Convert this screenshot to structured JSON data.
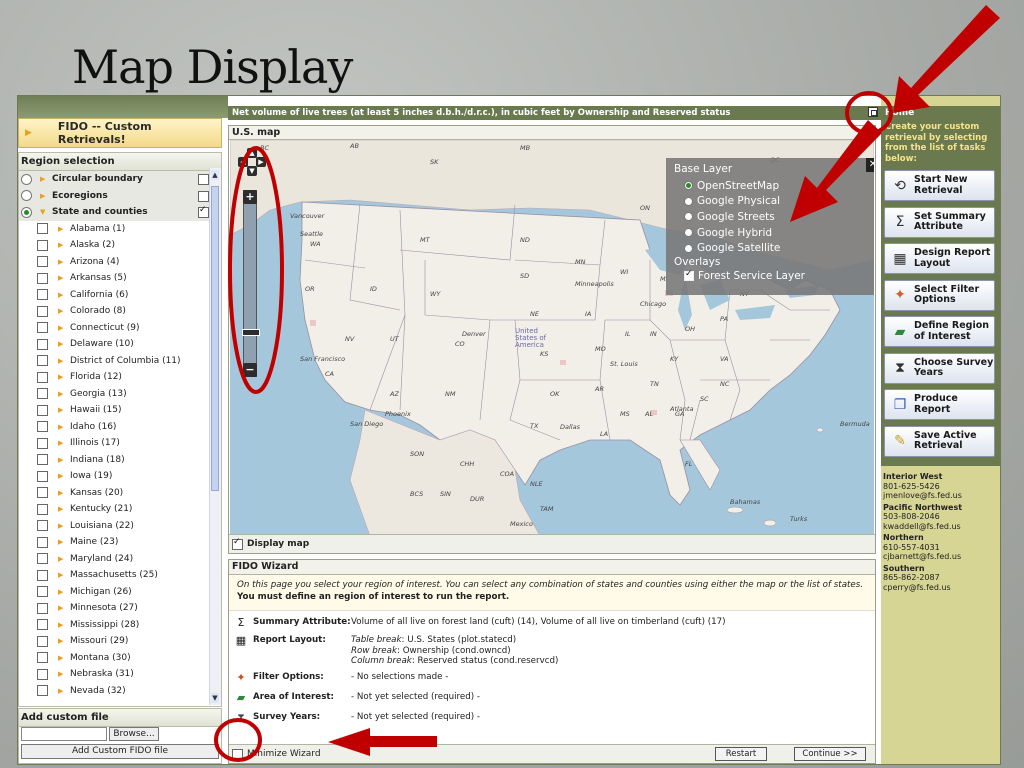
{
  "slide": {
    "title": "Map Display"
  },
  "left": {
    "header": "FIDO -- Custom Retrievals!",
    "region_title": "Region selection",
    "region_types": [
      {
        "label": "Circular boundary",
        "selected": false,
        "checked": false
      },
      {
        "label": "Ecoregions",
        "selected": false,
        "checked": false
      },
      {
        "label": "State and counties",
        "selected": true,
        "checked": true
      }
    ],
    "states": [
      "Alabama (1)",
      "Alaska (2)",
      "Arizona (4)",
      "Arkansas (5)",
      "California (6)",
      "Colorado (8)",
      "Connecticut (9)",
      "Delaware (10)",
      "District of Columbia (11)",
      "Florida (12)",
      "Georgia (13)",
      "Hawaii (15)",
      "Idaho (16)",
      "Illinois (17)",
      "Indiana (18)",
      "Iowa (19)",
      "Kansas (20)",
      "Kentucky (21)",
      "Louisiana (22)",
      "Maine (23)",
      "Maryland (24)",
      "Massachusetts (25)",
      "Michigan (26)",
      "Minnesota (27)",
      "Mississippi (28)",
      "Missouri (29)",
      "Montana (30)",
      "Nebraska (31)",
      "Nevada (32)"
    ],
    "add_custom": {
      "title": "Add custom file",
      "browse_label": "Browse...",
      "add_label": "Add Custom FIDO file"
    }
  },
  "center": {
    "title": "Net volume of live trees (at least 5 inches d.b.h./d.r.c.), in cubic feet by Ownership and Reserved status",
    "map_title": "U.S. map",
    "display_map_label": "Display map",
    "display_map_checked": true,
    "layers": {
      "base_header": "Base Layer",
      "base_options": [
        {
          "label": "OpenStreetMap",
          "selected": true
        },
        {
          "label": "Google Physical",
          "selected": false
        },
        {
          "label": "Google Streets",
          "selected": false
        },
        {
          "label": "Google Hybrid",
          "selected": false
        },
        {
          "label": "Google Satellite",
          "selected": false
        }
      ],
      "overlay_header": "Overlays",
      "overlay_label": "Forest Service Layer",
      "overlay_checked": true
    },
    "map_labels": [
      "BC",
      "AB",
      "SK",
      "MB",
      "QC",
      "ON",
      "WA",
      "OR",
      "CA",
      "NV",
      "ID",
      "MT",
      "WY",
      "UT",
      "CO",
      "AZ",
      "NM",
      "ND",
      "SD",
      "NE",
      "KS",
      "OK",
      "TX",
      "MN",
      "IA",
      "MO",
      "AR",
      "LA",
      "WI",
      "IL",
      "MS",
      "AL",
      "GA",
      "FL",
      "TN",
      "KY",
      "IN",
      "OH",
      "MI",
      "PA",
      "NY",
      "VA",
      "NC",
      "SC",
      "Vancouver",
      "Seattle",
      "Denver",
      "United States of America",
      "Dallas",
      "Chicago",
      "Minneapolis",
      "St. Louis",
      "Atlanta",
      "Phoenix",
      "San Diego",
      "San Francisco",
      "Bermuda",
      "Bahamas",
      "Mexico",
      "SON",
      "CHH",
      "COA",
      "NLE",
      "DUR",
      "SIN",
      "BCS",
      "TAM",
      "Turks"
    ],
    "wizard": {
      "title": "FIDO Wizard",
      "intro": "On this page you select your region of interest. You can select any combination of states and counties using either the map or the list of states.",
      "intro_bold": "You must define an region of interest to run the report.",
      "summary_label": "Summary Attribute:",
      "summary_value": "Volume of all live on forest land (cuft) (14), Volume of all live on timberland (cuft) (17)",
      "layout_label": "Report Layout:",
      "layout_table_key": "Table break",
      "layout_table_val": ": U.S. States (plot.statecd)",
      "layout_row_key": "Row break",
      "layout_row_val": ": Ownership (cond.owncd)",
      "layout_col_key": "Column break",
      "layout_col_val": ": Reserved status (cond.reservcd)",
      "filter_label": "Filter Options:",
      "filter_value": "- No selections made -",
      "area_label": "Area of Interest:",
      "area_value": "- Not yet selected (required) -",
      "years_label": "Survey Years:",
      "years_value": "- Not yet selected (required) -",
      "minimize_label": "Minimize Wizard",
      "restart_label": "Restart",
      "continue_label": "Continue >>"
    }
  },
  "right": {
    "home": "Home",
    "desc": "Create your custom retrieval by selecting from the list of tasks below:",
    "tasks": [
      {
        "label": "Start New Retrieval",
        "icon": "start-icon"
      },
      {
        "label": "Set Summary Attribute",
        "icon": "sigma-icon"
      },
      {
        "label": "Design Report Layout",
        "icon": "grid-icon"
      },
      {
        "label": "Select Filter Options",
        "icon": "filter-icon"
      },
      {
        "label": "Define Region of Interest",
        "icon": "map-icon"
      },
      {
        "label": "Choose Survey Years",
        "icon": "hourglass-icon"
      },
      {
        "label": "Produce Report",
        "icon": "report-icon"
      },
      {
        "label": "Save Active Retrieval",
        "icon": "save-icon"
      }
    ],
    "contacts": [
      {
        "region": "Interior West",
        "phone": "801-625-5426",
        "email": "jmenlove@fs.fed.us"
      },
      {
        "region": "Pacific Northwest",
        "phone": "503-808-2046",
        "email": "kwaddell@fs.fed.us"
      },
      {
        "region": "Northern",
        "phone": "610-557-4031",
        "email": "cjbarnett@fs.fed.us"
      },
      {
        "region": "Southern",
        "phone": "865-862-2087",
        "email": "cperry@fs.fed.us"
      }
    ]
  },
  "colors": {
    "accent_green": "#6b7a4e",
    "annotation_red": "#c00000",
    "right_panel": "#d7d594"
  }
}
